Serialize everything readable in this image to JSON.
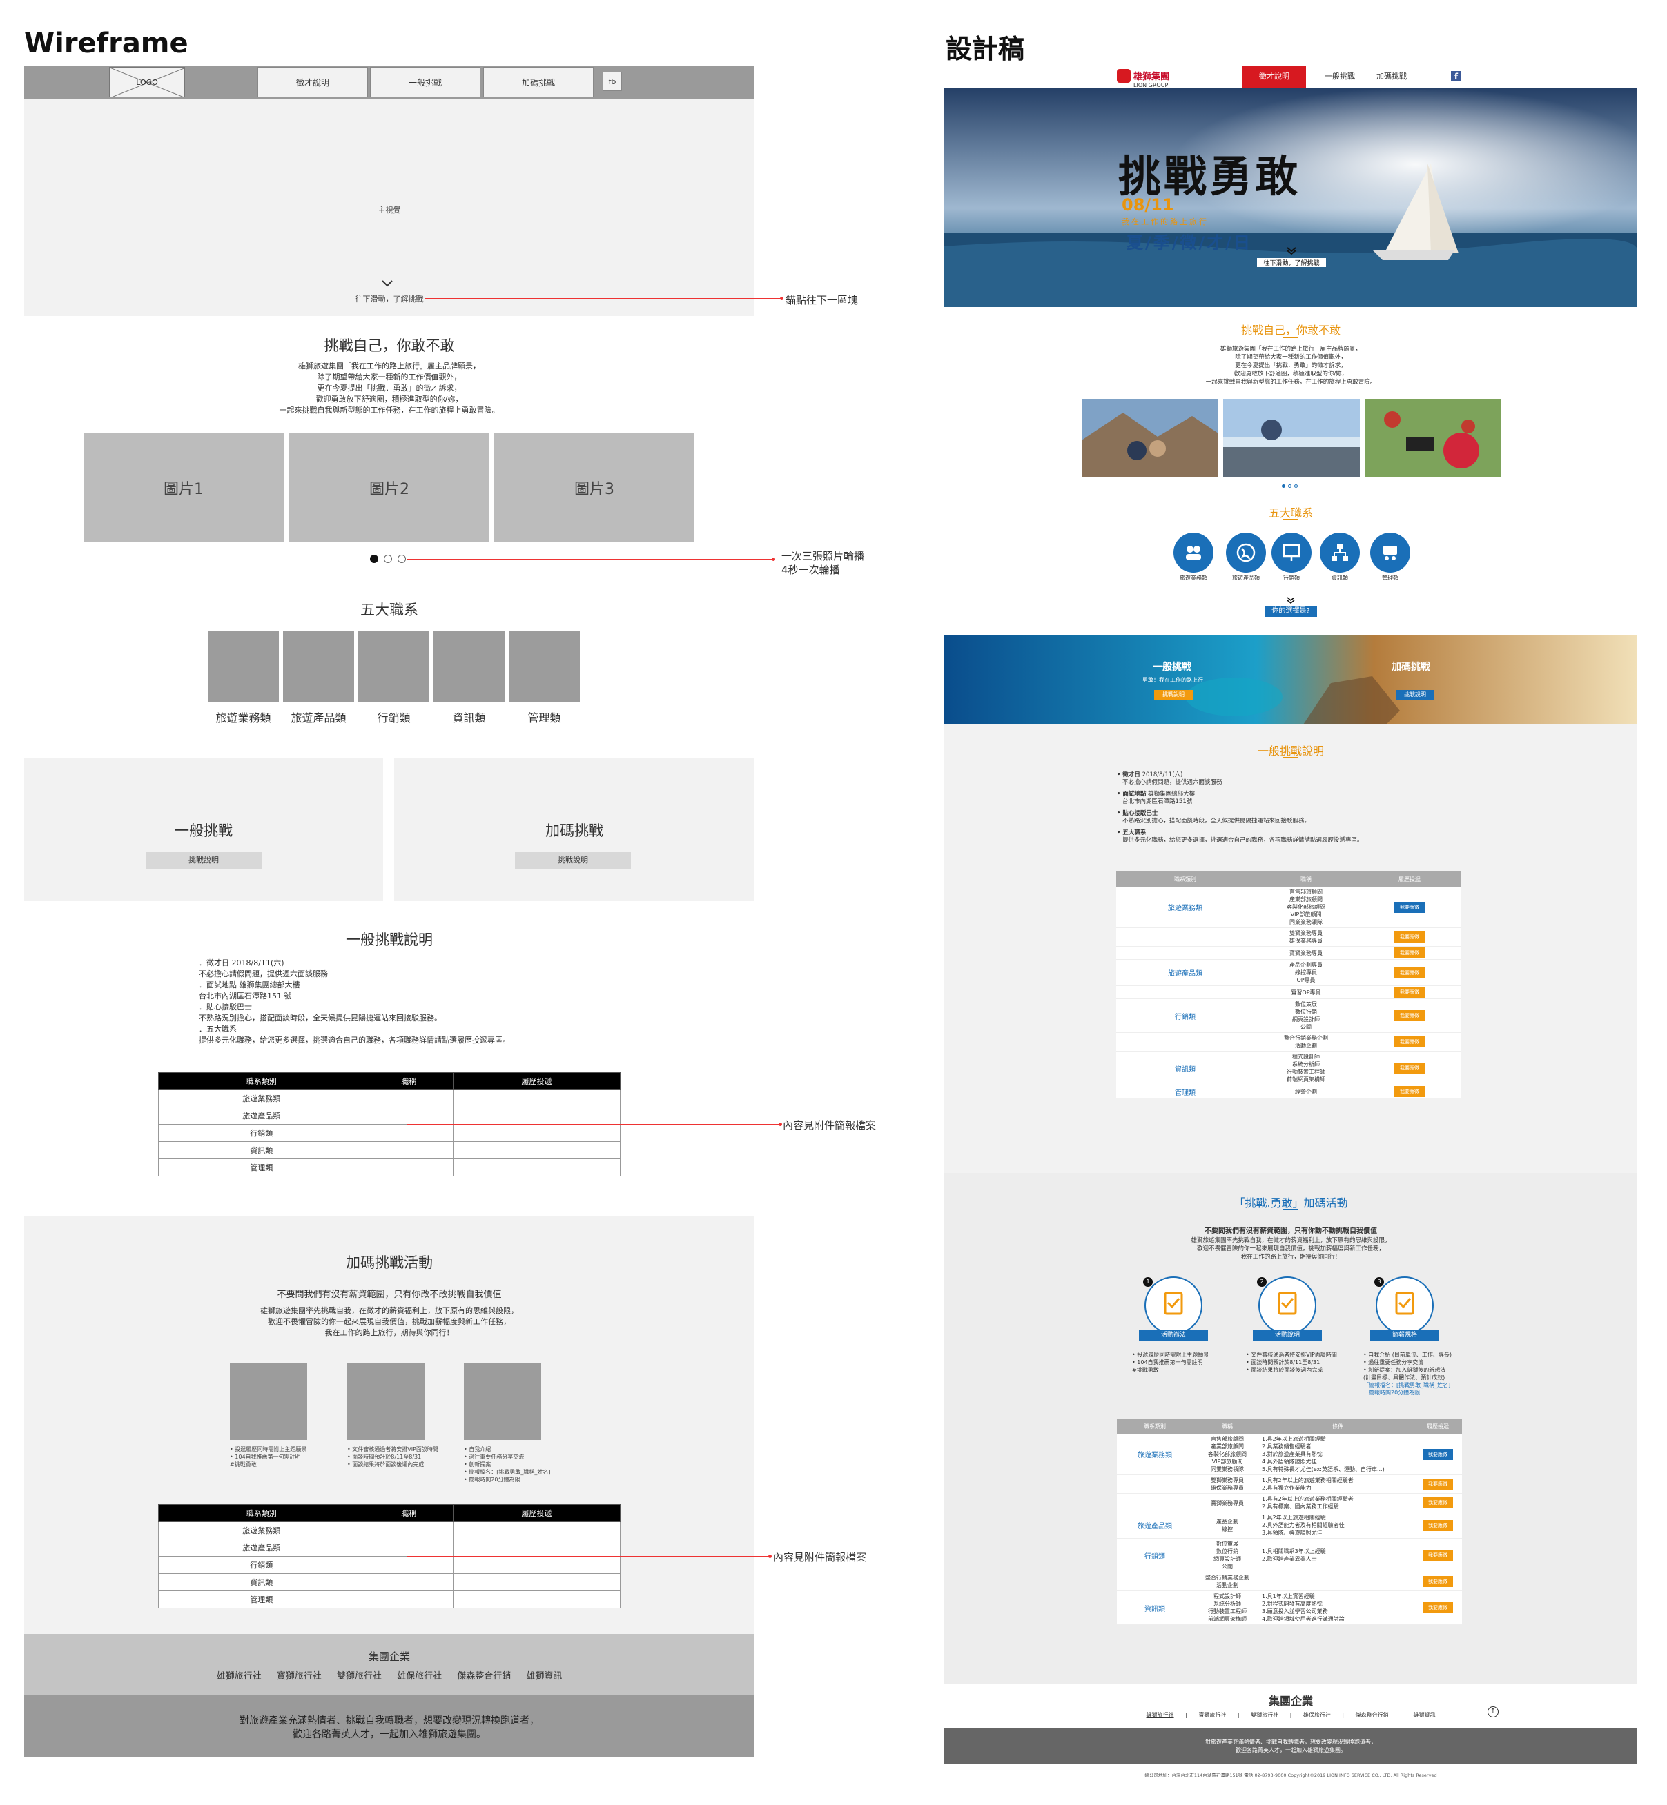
{
  "wireframe": {
    "title": "Wireframe",
    "logo": "LOGO",
    "nav": [
      "徵才說明",
      "一般挑戰",
      "加碼挑戰"
    ],
    "fb": "fb",
    "hero_label": "主視覺",
    "scroll_text": "往下滑動，了解挑戰",
    "anchor_note": "錨點往下一區塊",
    "intro_title": "挑戰自己，你敢不敢",
    "intro_lines": [
      "雄獅旅遊集團「我在工作的路上旅行」雇主品牌願景，",
      "除了期望帶給大家一種新的工作價值觀外，",
      "更在今夏提出「挑戰．勇敢」的徵才訴求，",
      "歡迎勇敢放下舒適圈，積極進取型的你/妳，",
      "一起來挑戰自我與新型態的工作任務，在工作的旅程上勇敢冒險。"
    ],
    "images": [
      "圖片1",
      "圖片2",
      "圖片3"
    ],
    "carousel_note_1": "一次三張照片輪播",
    "carousel_note_2": "4秒一次輪播",
    "five_title": "五大職系",
    "five_items": [
      "旅遊業務類",
      "旅遊產品類",
      "行銷類",
      "資訊類",
      "管理類"
    ],
    "challenge_general": "一般挑戰",
    "challenge_bonus": "加碼挑戰",
    "challenge_btn": "挑戰說明",
    "general_title": "一般挑戰說明",
    "general_lines": [
      "．徵才日 2018/8/11(六)",
      "不必擔心請假問題，提供週六面談服務",
      "．面試地點 雄獅集團總部大樓",
      "台北市內湖區石潭路151 號",
      "．貼心接駁巴士",
      "不熟路況別擔心，搭配面談時段，全天候提供昆陽捷運站來回接駁服務。",
      "．五大職系",
      "提供多元化職務，給您更多選擇，挑選適合自己的職務，各項職務詳情請點選履歷投遞專區。"
    ],
    "table_headers": [
      "職系類別",
      "職稱",
      "履歷投遞"
    ],
    "table_rows": [
      "旅遊業務類",
      "旅遊產品類",
      "行銷類",
      "資訊類",
      "管理類"
    ],
    "table_note": "內容見附件簡報檔案",
    "bonus_title": "加碼挑戰活動",
    "bonus_sub": "不要問我們有沒有薪資範圍，只有你改不改挑戰自我價值",
    "bonus_lines": [
      "雄獅旅遊集團率先挑戰自我，在徵才的薪資福利上，放下原有的思維與設限，",
      "歡迎不畏懼冒險的你一起來展現自我價值，挑戰加薪幅度與新工作任務，",
      "我在工作的路上旅行，期待與你同行！"
    ],
    "bonus_bullets": [
      [
        "• 投遞履歷同時需附上主題願景",
        "• 104自我推薦第一句需註明",
        "  #挑戰勇敢"
      ],
      [
        "• 文件審核通過者將安排VIP面談時間",
        "• 面談時間預計於8/11至8/31",
        "• 面談結果將於面談後週內完成"
      ],
      [
        "• 自我介紹",
        "• 過往重要任務分享交流",
        "• 創新提案",
        "• 簡報檔名：[挑戰勇敢_職稱_姓名]",
        "• 簡報時間20分鐘為限"
      ]
    ],
    "table2_note": "內容見附件簡報檔案",
    "group_title": "集團企業",
    "group_items": [
      "雄獅旅行社",
      "寶獅旅行社",
      "雙獅旅行社",
      "雄保旅行社",
      "傑森整合行銷",
      "雄獅資訊"
    ],
    "footer_lines": [
      "對旅遊產業充滿熱情者、挑戰自我轉職者，想要改變現況轉換跑道者，",
      "歡迎各路菁英人才，一起加入雄獅旅遊集團。"
    ]
  },
  "design": {
    "title": "設計稿",
    "logo": "雄獅集團",
    "logo_sub": "LION GROUP",
    "nav": [
      "徵才說明",
      "一般挑戰",
      "加碼挑戰"
    ],
    "hero_calligraphy": "挑戰勇敢",
    "hero_date": "08/11",
    "hero_tag": "我在工作的路上旅行",
    "hero_event": "夏/季/徵/才/日",
    "scroll_text": "往下滑動，了解挑戰",
    "intro_title": "挑戰自己，你敢不敢",
    "intro_lines": [
      "雄獅旅遊集團「我在工作的路上旅行」雇主品牌願景，",
      "除了期望帶給大家一種新的工作價值觀外，",
      "更在今夏提出「挑戰．勇敢」的徵才訴求，",
      "歡迎勇敢放下舒適圈，積極進取型的你/妳，",
      "一起來挑戰自我與新型態的工作任務，在工作的旅程上勇敢冒險。"
    ],
    "five_title": "五大職系",
    "five_items": [
      "旅遊業務類",
      "旅遊產品類",
      "行銷類",
      "資訊類",
      "管理類"
    ],
    "choice_badge": "你的選擇是?",
    "banner_general": "一般挑戰",
    "banner_general_sub": "勇敢！我在工作的路上行",
    "banner_bonus": "加碼挑戰",
    "banner_btn": "挑戰說明",
    "general_title": "一般挑戰說明",
    "general_items": [
      {
        "label": "徵才日",
        "text": "2018/8/11(六)",
        "sub": "不必擔心請假問題，提供週六面談服務"
      },
      {
        "label": "面試地點",
        "text": "雄獅集團總部大樓",
        "sub": "台北市內湖區石潭路151號"
      },
      {
        "label": "貼心接駁巴士",
        "text": "",
        "sub": "不熟路況別擔心，搭配面談時段，全天候提供昆陽捷運站來回接駁服務。"
      },
      {
        "label": "五大職系",
        "text": "",
        "sub": "提供多元化職務，給您更多選擇，挑選適合自己的職務，各項職務詳情請點選履歷投遞專區。"
      }
    ],
    "table_headers": [
      "職系類別",
      "職稱",
      "履歷投遞"
    ],
    "apply_btn": "我要應徵",
    "table_rows": [
      {
        "cat": "旅遊業務類",
        "jobs": [
          "直售部旅顧問",
          "產業部旅顧問",
          "客製化部旅顧問",
          "VIP部旅顧問",
          "同業業務領隊"
        ],
        "btn": "blue"
      },
      {
        "cat": "",
        "jobs": [
          "雙獅業務專員",
          "雄保業務專員"
        ],
        "btn": "orange"
      },
      {
        "cat": "",
        "jobs": [
          "寶獅業務專員"
        ],
        "btn": "orange"
      },
      {
        "cat": "旅遊產品類",
        "jobs": [
          "產品企劃專員",
          "線控專員",
          "OP專員"
        ],
        "btn": "orange"
      },
      {
        "cat": "",
        "jobs": [
          "實習OP專員"
        ],
        "btn": "orange"
      },
      {
        "cat": "行銷類",
        "jobs": [
          "數位策展",
          "數位行銷",
          "網頁設計師",
          "公關"
        ],
        "btn": "orange"
      },
      {
        "cat": "",
        "jobs": [
          "整合行銷業務企劃",
          "活動企劃"
        ],
        "btn": "orange"
      },
      {
        "cat": "資訊類",
        "jobs": [
          "程式設計師",
          "系統分析師",
          "行動裝置工程師",
          "前端網頁架構師"
        ],
        "btn": "orange"
      },
      {
        "cat": "管理類",
        "jobs": [
          "經營企劃"
        ],
        "btn": "orange"
      }
    ],
    "bonus_title": "「挑戰.勇敢」加碼活動",
    "bonus_sub": "不要問我們有沒有薪資範圍，只有你動不動挑戰自我價值",
    "bonus_lines": [
      "雄獅旅遊集團率先挑戰自我，在徵才的薪資福利上，放下原有的思維與設限，",
      "歡迎不畏懼冒險的你一起來展現自我價值，挑戰加薪幅度與新工作任務，",
      "我在工作的路上旅行，期待與你同行！"
    ],
    "steps": [
      {
        "num": "1",
        "label": "活動辦法",
        "bullets": [
          "• 投遞履歷同時需附上主題願景",
          "• 104自我推薦第一句需註明",
          "  #挑戰勇敢"
        ]
      },
      {
        "num": "2",
        "label": "活動說明",
        "bullets": [
          "• 文件審核通過者將安排VIP面談時間",
          "• 面談時間預計於8/11至8/31",
          "• 面談結果將於面談後週內完成"
        ]
      },
      {
        "num": "3",
        "label": "簡報規格",
        "bullets": [
          "• 自我介紹 (目前單位、工作、專長)",
          "• 過往重要任務分享交流",
          "• 創新提案：加入雄獅後的新想法",
          "  (計畫目標、具體作法、預計成效)",
          "「簡報檔名：[挑戰勇敢_職稱_姓名]",
          "「簡報時間20分鐘為限"
        ]
      }
    ],
    "table2_headers": [
      "職系類別",
      "職稱",
      "條件",
      "履歷投遞"
    ],
    "table2_rows": [
      {
        "cat": "旅遊業務類",
        "jobs": [
          "直售部旅顧問",
          "產業部旅顧問",
          "客製化部旅顧問",
          "VIP部旅顧問",
          "同業業務領隊"
        ],
        "cond": [
          "1.具2年以上旅遊相關經驗",
          "2.具業務銷售經驗者",
          "3.對於旅遊產業具有熱忱",
          "4.具外語領隊證照尤佳",
          "5.具有特殊長才尤佳(ex:英語系、運動、自行車...)"
        ],
        "btn": "blue"
      },
      {
        "cat": "",
        "jobs": [
          "雙獅業務專員",
          "雄保業務專員"
        ],
        "cond": [
          "1.具有2年以上的旅遊業務相關經驗者",
          "2.具有獨立作業能力"
        ],
        "btn": "orange"
      },
      {
        "cat": "",
        "jobs": [
          "寶獅業務專員"
        ],
        "cond": [
          "1.具有2年以上的旅遊業務相關經驗者",
          "2.具有標案、國內業務工作經驗"
        ],
        "btn": "orange"
      },
      {
        "cat": "旅遊產品類",
        "jobs": [
          "產品企劃",
          "線控"
        ],
        "cond": [
          "1.具2年以上旅遊相關經驗",
          "2.具外語能力者及有相關經驗者佳",
          "3.具領隊、導遊證照尤佳"
        ],
        "btn": "orange"
      },
      {
        "cat": "行銷類",
        "jobs": [
          "數位策展",
          "數位行銷",
          "網頁設計師",
          "公關"
        ],
        "cond": [
          "1.具相關職系3年以上經驗",
          "2.歡迎跨產業異業人士"
        ],
        "btn": "orange"
      },
      {
        "cat": "",
        "jobs": [
          "整合行銷業務企劃",
          "活動企劃"
        ],
        "cond": [],
        "btn": "orange"
      },
      {
        "cat": "資訊類",
        "jobs": [
          "程式設計師",
          "系統分析師",
          "行動裝置工程師",
          "前端網頁架構師"
        ],
        "cond": [
          "1.具1年以上實習經驗",
          "2.對程式開發有高度熱忱",
          "3.願意投入並學習公司業務",
          "4.歡迎跨領域使用者進行溝通討論"
        ],
        "btn": "orange"
      }
    ],
    "group_title": "集團企業",
    "group_items": [
      "雄獅旅行社",
      "寶獅旅行社",
      "雙獅旅行社",
      "雄保旅行社",
      "傑森整合行銷",
      "雄獅資訊"
    ],
    "footer_lines": [
      "對旅遊產業充滿熱情者、挑戰自我轉職者，想要改變現況轉換跑道者，",
      "歡迎各路菁英人才，一起加入雄獅旅遊集團。"
    ],
    "copyright": "總公司地址：台灣台北市114內湖區石潭路151號 電話:02-8793-9000 Copyright©2019 LION INFO SERVICE CO., LTD. All Rights Reserved",
    "colors": {
      "accent": "#e8940e",
      "blue": "#1a6fb8",
      "red": "#d71920"
    }
  }
}
